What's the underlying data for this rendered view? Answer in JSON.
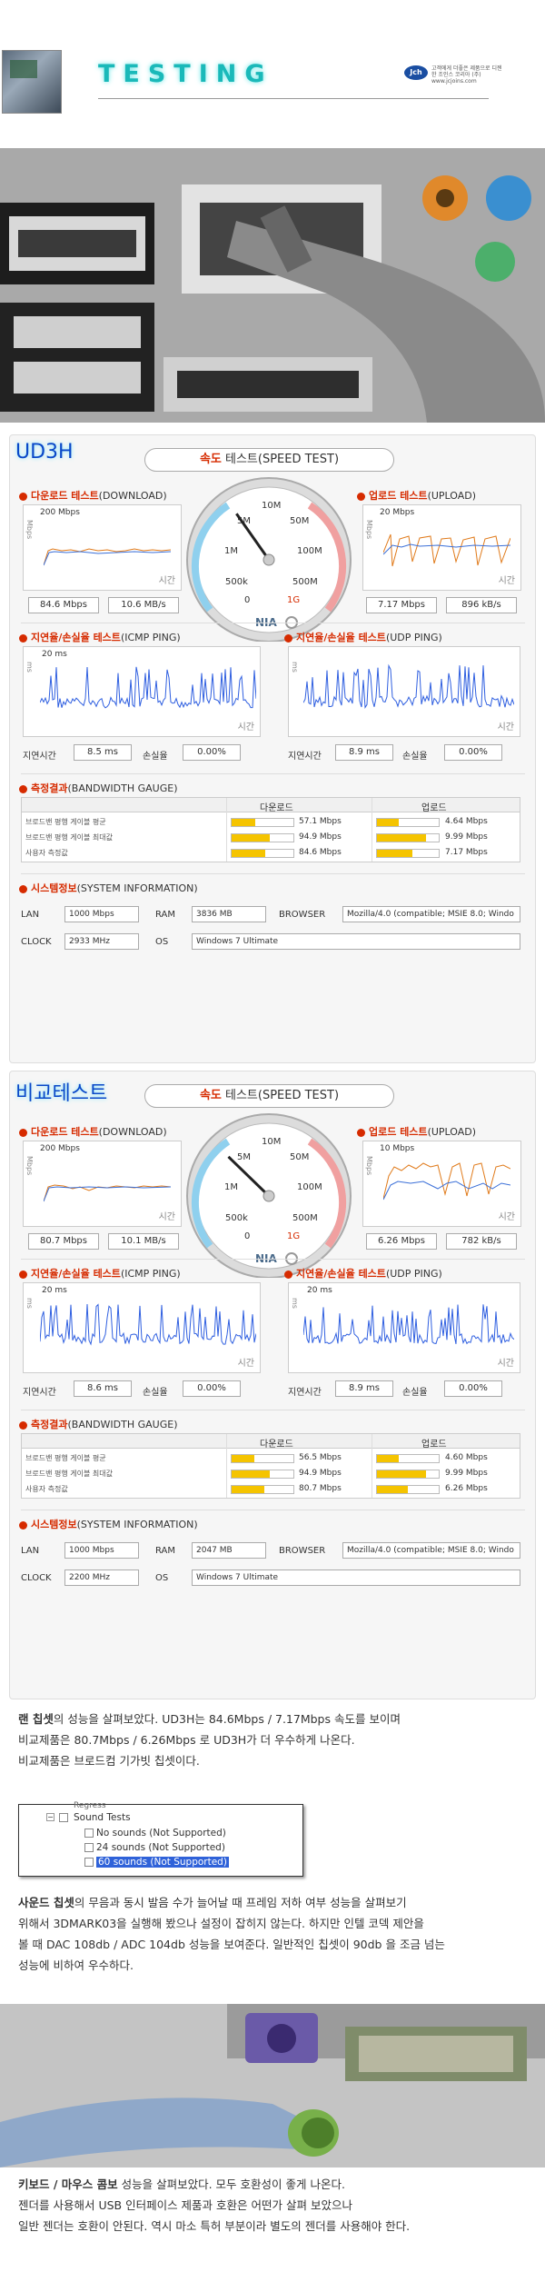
{
  "header": {
    "title": "TESTING",
    "logo_mark": "Jch",
    "logo_text": "고객에게 더좋은 제품으로 디젠한 조인스 코리아 (주) www.jcjoins.com"
  },
  "panel1": {
    "title": "UD3H",
    "speed_title_red": "속도",
    "speed_title_rest": "테스트(SPEED TEST)",
    "download": {
      "red": "다운로드 테스트",
      "rest": "(DOWNLOAD)",
      "scale": "200 Mbps",
      "value1": "84.6 Mbps",
      "value2": "10.6 MB/s",
      "time": "시간"
    },
    "upload": {
      "red": "업로드 테스트",
      "rest": "(UPLOAD)",
      "scale": "20 Mbps",
      "value1": "7.17 Mbps",
      "value2": "896 kB/s",
      "time": "시간"
    },
    "icmp": {
      "red": "지연율/손실율 테스트",
      "rest": "(ICMP PING)",
      "scale": "20 ms",
      "delay_label": "지연시간",
      "delay": "8.5 ms",
      "loss_label": "손실율",
      "loss": "0.00%",
      "time": "시간"
    },
    "udp": {
      "red": "지연율/손실율 테스트",
      "rest": "(UDP PING)",
      "delay_label": "지연시간",
      "delay": "8.9 ms",
      "loss_label": "손실율",
      "loss": "0.00%",
      "time": "시간"
    },
    "bandwidth": {
      "red": "측정결과",
      "rest": "(BANDWIDTH GAUGE)",
      "col_down": "다운로드",
      "col_up": "업로드",
      "rows": [
        {
          "label": "브로드밴 평행 게이블 평균",
          "down": "57.1 Mbps",
          "up": "4.64 Mbps",
          "down_frac": 0.38,
          "up_frac": 0.35
        },
        {
          "label": "브로드밴 평행 게이블 최대값",
          "down": "94.9 Mbps",
          "up": "9.99 Mbps",
          "down_frac": 0.62,
          "up_frac": 0.8
        },
        {
          "label": "사용자 측정값",
          "down": "84.6 Mbps",
          "up": "7.17 Mbps",
          "down_frac": 0.55,
          "up_frac": 0.57
        }
      ]
    },
    "system": {
      "red": "시스템정보",
      "rest": "(SYSTEM INFORMATION)",
      "lan_label": "LAN",
      "lan": "1000 Mbps",
      "ram_label": "RAM",
      "ram": "3836 MB",
      "browser_label": "BROWSER",
      "browser": "Mozilla/4.0 (compatible; MSIE 8.0; Windo",
      "clock_label": "CLOCK",
      "clock": "2933 MHz",
      "os_label": "OS",
      "os": "Windows 7 Ultimate"
    },
    "gauge": {
      "needle_value": 0.37
    }
  },
  "panel2": {
    "title": "비교테스트",
    "speed_title_red": "속도",
    "speed_title_rest": "테스트(SPEED TEST)",
    "download": {
      "red": "다운로드 테스트",
      "rest": "(DOWNLOAD)",
      "scale": "200 Mbps",
      "value1": "80.7 Mbps",
      "value2": "10.1 MB/s",
      "time": "시간"
    },
    "upload": {
      "red": "업로드 테스트",
      "rest": "(UPLOAD)",
      "scale": "10 Mbps",
      "value1": "6.26 Mbps",
      "value2": "782 kB/s",
      "time": "시간"
    },
    "icmp": {
      "red": "지연율/손실율 테스트",
      "rest": "(ICMP PING)",
      "scale": "20 ms",
      "delay_label": "지연시간",
      "delay": "8.6 ms",
      "loss_label": "손실율",
      "loss": "0.00%",
      "time": "시간"
    },
    "udp": {
      "red": "지연율/손실율 테스트",
      "rest": "(UDP PING)",
      "scale": "20 ms",
      "delay_label": "지연시간",
      "delay": "8.9 ms",
      "loss_label": "손실율",
      "loss": "0.00%",
      "time": "시간"
    },
    "bandwidth": {
      "red": "측정결과",
      "rest": "(BANDWIDTH GAUGE)",
      "col_down": "다운로드",
      "col_up": "업로드",
      "rows": [
        {
          "label": "브로드밴 평행 게이블 평균",
          "down": "56.5 Mbps",
          "up": "4.60 Mbps",
          "down_frac": 0.37,
          "up_frac": 0.35
        },
        {
          "label": "브로드밴 평행 게이블 최대값",
          "down": "94.9 Mbps",
          "up": "9.99 Mbps",
          "down_frac": 0.62,
          "up_frac": 0.8
        },
        {
          "label": "사용자 측정값",
          "down": "80.7 Mbps",
          "up": "6.26 Mbps",
          "down_frac": 0.53,
          "up_frac": 0.5
        }
      ]
    },
    "system": {
      "red": "시스템정보",
      "rest": "(SYSTEM INFORMATION)",
      "lan_label": "LAN",
      "lan": "1000 Mbps",
      "ram_label": "RAM",
      "ram": "2047 MB",
      "browser_label": "BROWSER",
      "browser": "Mozilla/4.0 (compatible; MSIE 8.0; Windo",
      "clock_label": "CLOCK",
      "clock": "2200 MHz",
      "os_label": "OS",
      "os": "Windows 7 Ultimate"
    },
    "gauge": {
      "needle_value": 0.33
    }
  },
  "gauge_labels": {
    "l0": "0",
    "l500k": "500k",
    "l1m": "1M",
    "l5m": "5M",
    "l10m": "10M",
    "l50m": "50M",
    "l100m": "100M",
    "l500m": "500M",
    "l1g": "1G",
    "brand": "NIA"
  },
  "lan_text": {
    "bold": "랜 칩셋",
    "line1": "의 성능을 살펴보았다. UD3H는 84.6Mbps / 7.17Mbps 속도를 보이며",
    "line2": "비교제품은 80.7Mbps / 6.26Mbps 로 UD3H가 더 우수하게 나온다.",
    "line3": "비교제품은 브로드컴 기가빗 칩셋이다."
  },
  "sound_shot": {
    "top_item": "Regress",
    "parent": "Sound Tests",
    "items": [
      "No sounds (Not Supported)",
      "24 sounds (Not Supported)",
      "60 sounds (Not Supported)"
    ]
  },
  "sound_text": {
    "bold": "사운드 칩셋",
    "line1": "의 무음과 동시 발음 수가 늘어날 때 프레임 저하 여부 성능을 살펴보기",
    "line2": "위해서 3DMARK03을 실행해 봤으나 설정이 잡히지 않는다. 하지만 인텔 코덱 제안을",
    "line3": "볼 때 DAC 108db / ADC 104db 성능을 보여준다. 일반적인 칩셋이 90db 을 조금 넘는",
    "line4": "성능에 비하여 우수하다."
  },
  "kb_text": {
    "bold": "키보드 / 마우스 콤보",
    "line1": " 성능을 살펴보았다. 모두 호환성이 좋게 나온다.",
    "line2": "젠더를 사용해서 USB 인터페이스 제품과 호환은 어떤가 살펴 보았으나",
    "line3": "일반 젠더는 호환이 안된다. 역시 마소 특허 부분이라 별도의 젠더를 사용해야 한다."
  }
}
